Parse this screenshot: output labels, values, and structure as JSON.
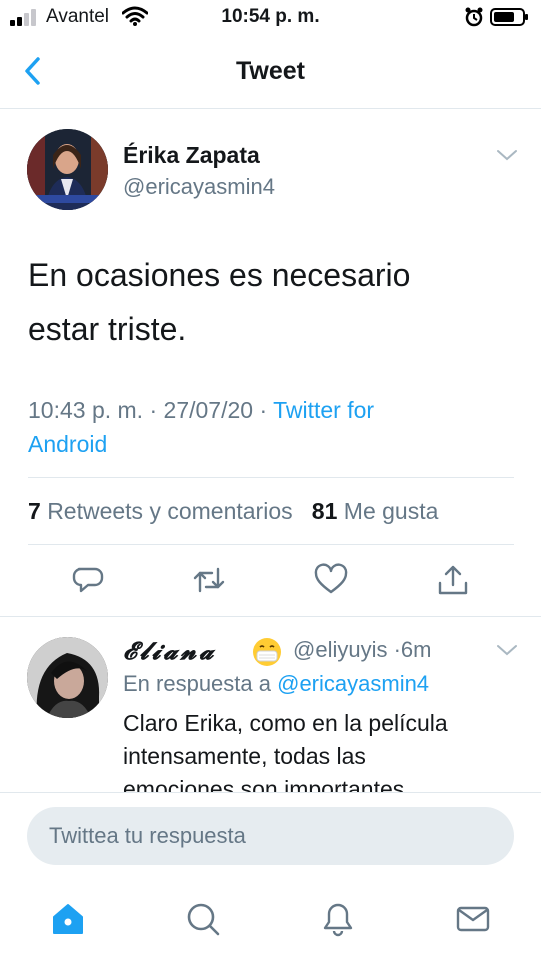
{
  "status_bar": {
    "carrier": "Avantel",
    "time": "10:54 p. m."
  },
  "nav": {
    "title": "Tweet"
  },
  "tweet": {
    "display_name": "Érika Zapata",
    "handle": "@ericayasmin4",
    "text_line1": "En ocasiones es necesario",
    "text_line2": "estar triste.",
    "time": "10:43 p. m.",
    "sep1": "·",
    "date": "27/07/20",
    "sep2": "·",
    "source_line1": "Twitter for",
    "source_line2": "Android",
    "retweets_count": "7",
    "retweets_label": "Retweets y comentarios",
    "likes_count": "81",
    "likes_label": "Me gusta"
  },
  "reply": {
    "display_name": "𝓔𝓵𝓲𝓪𝓷𝓪",
    "handle": "@eliyuyis",
    "sep": "·",
    "time": "6m",
    "in_reply_prefix": "En respuesta a",
    "in_reply_to": "@ericayasmin4",
    "text_line1": "Claro Erika, como en la película",
    "text_line2": "intensamente, todas las",
    "text_line3": "emociones son importantes"
  },
  "composer": {
    "placeholder": "Twittea tu respuesta"
  },
  "colors": {
    "accent": "#1da1f2",
    "secondary": "#657786",
    "divider": "#e1e8ed"
  },
  "icons": {
    "back": "chevron-left-icon",
    "reply": "comment-icon",
    "retweet": "retweet-icon",
    "like": "heart-icon",
    "share": "share-icon",
    "tabs": [
      "home-icon",
      "search-icon",
      "bell-icon",
      "mail-icon"
    ]
  }
}
